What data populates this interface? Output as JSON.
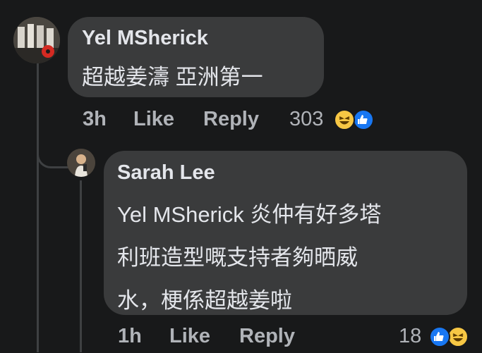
{
  "comment": {
    "author": "Yel MSherick",
    "text": "超越姜濤 亞洲第一",
    "time": "3h",
    "like_label": "Like",
    "reply_label": "Reply",
    "reaction_count": "303",
    "reactions": [
      "haha-icon",
      "like-icon"
    ]
  },
  "reply": {
    "author": "Sarah Lee",
    "text_lines": [
      "Yel MSherick 炎仲有好多塔",
      "利班造型嘅支持者夠晒威",
      "水，梗係超越姜啦"
    ],
    "time": "1h",
    "like_label": "Like",
    "reply_label": "Reply",
    "reaction_count": "18",
    "reactions": [
      "like-icon",
      "haha-icon"
    ]
  },
  "colors": {
    "background": "#18191a",
    "bubble": "#3a3b3c",
    "text_primary": "#e4e6eb",
    "text_secondary": "#b0b3b8",
    "like_blue": "#1877f2",
    "haha_yellow": "#f7c744"
  }
}
